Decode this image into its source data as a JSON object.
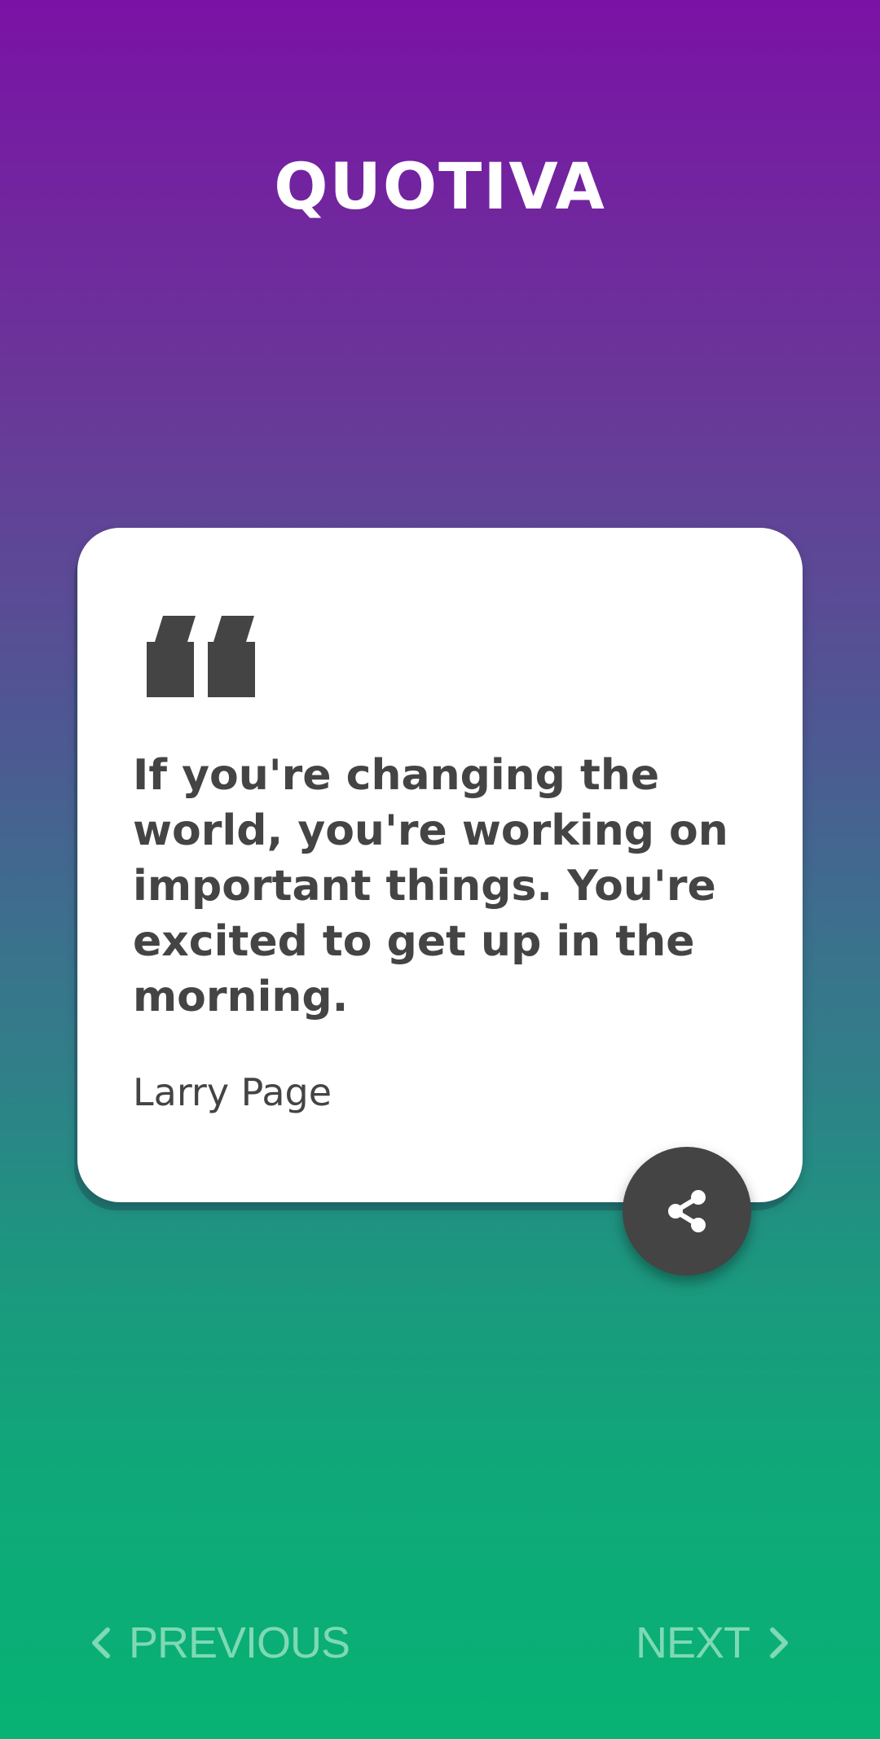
{
  "app": {
    "title": "QUOTIVA"
  },
  "quote": {
    "text": "If you're changing the world, you're working on important things. You're excited to get up in the morning.",
    "author": "Larry Page",
    "quote_icon": "quote-mark-icon"
  },
  "share": {
    "icon": "share-icon"
  },
  "navigation": {
    "previous_label": "PREVIOUS",
    "next_label": "NEXT",
    "previous_icon": "chevron-left-icon",
    "next_icon": "chevron-right-icon"
  },
  "colors": {
    "gradient_top": "#7a12a6",
    "gradient_bottom": "#07b274",
    "card_background": "#ffffff",
    "text_dark": "#444444",
    "nav_text": "#7ed9b4"
  }
}
